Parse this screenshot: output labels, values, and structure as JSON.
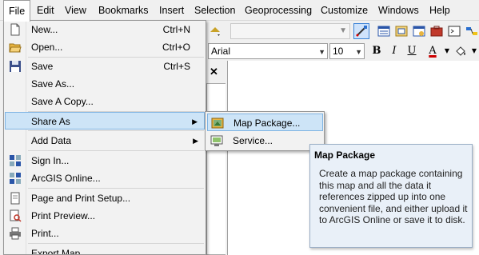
{
  "menubar": {
    "items": [
      "File",
      "Edit",
      "View",
      "Bookmarks",
      "Insert",
      "Selection",
      "Geoprocessing",
      "Customize",
      "Windows",
      "Help"
    ]
  },
  "toolbar2": {
    "font": "Arial",
    "size": "10",
    "bold": "B",
    "italic": "I",
    "underline": "U",
    "fontcolor": "A"
  },
  "file_menu": {
    "items": [
      {
        "label": "New...",
        "shortcut": "Ctrl+N",
        "icon": "new-document-icon"
      },
      {
        "label": "Open...",
        "shortcut": "Ctrl+O",
        "icon": "open-folder-icon"
      },
      {
        "label": "Save",
        "shortcut": "Ctrl+S",
        "icon": "save-disk-icon"
      },
      {
        "label": "Save As...",
        "shortcut": "",
        "icon": ""
      },
      {
        "label": "Save A Copy...",
        "shortcut": "",
        "icon": ""
      },
      {
        "label": "Share As",
        "shortcut": "",
        "icon": ""
      },
      {
        "label": "Add Data",
        "shortcut": "",
        "icon": ""
      },
      {
        "label": "Sign In...",
        "shortcut": "",
        "icon": "sign-in-icon"
      },
      {
        "label": "ArcGIS Online...",
        "shortcut": "",
        "icon": "arcgis-online-icon"
      },
      {
        "label": "Page and Print Setup...",
        "shortcut": "",
        "icon": "page-setup-icon"
      },
      {
        "label": "Print Preview...",
        "shortcut": "",
        "icon": "print-preview-icon"
      },
      {
        "label": "Print...",
        "shortcut": "",
        "icon": "printer-icon"
      },
      {
        "label": "Export Map...",
        "shortcut": "",
        "icon": ""
      }
    ]
  },
  "share_submenu": {
    "items": [
      {
        "label": "Map Package...",
        "icon": "map-package-icon"
      },
      {
        "label": "Service...",
        "icon": "service-icon"
      }
    ]
  },
  "tooltip": {
    "title": "Map Package",
    "body": "Create a map package containing this map and all the data it references zipped up into one convenient file, and either upload it to ArcGIS Online or save it to disk."
  },
  "pane": {
    "close": "✕"
  },
  "colors": {
    "highlight": "#cde4f7",
    "highlight_border": "#7fb4e3",
    "tooltip_bg": "#e9f0f8"
  }
}
